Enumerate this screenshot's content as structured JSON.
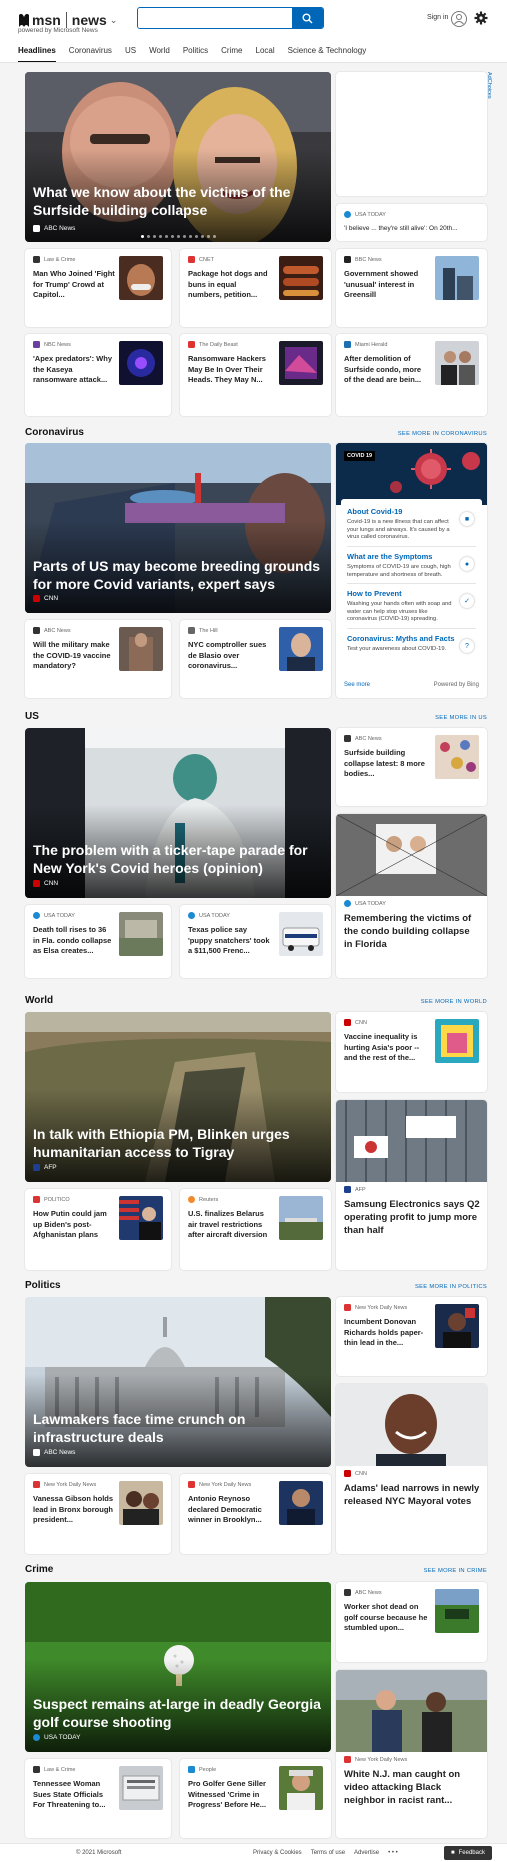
{
  "header": {
    "brand_msn": "msn",
    "brand_news": "news",
    "powered_by": "powered by Microsoft News",
    "search_placeholder": "",
    "signin": "Sign in"
  },
  "nav": [
    "Headlines",
    "Coronavirus",
    "US",
    "World",
    "Politics",
    "Crime",
    "Local",
    "Science & Technology"
  ],
  "adchoices": "AdChoices",
  "headlines": {
    "hero": {
      "title": "What we know about the victims of the Surfside building collapse",
      "source": "ABC News"
    },
    "side_card": {
      "source": "USA TODAY",
      "text": "'I believe ... they're still alive': On 20th..."
    },
    "cards": [
      {
        "source": "Law & Crime",
        "title": "Man Who Joined 'Fight for Trump' Crowd at Capitol..."
      },
      {
        "source": "CNET",
        "title": "Package hot dogs and buns in equal numbers, petition..."
      },
      {
        "source": "BBC News",
        "title": "Government showed 'unusual' interest in Greensill"
      },
      {
        "source": "NBC News",
        "title": "'Apex predators': Why the Kaseya ransomware attack..."
      },
      {
        "source": "The Daily Beast",
        "title": "Ransomware Hackers May Be In Over Their Heads. They May N..."
      },
      {
        "source": "Miami Herald",
        "title": "After demolition of Surfside condo, more of the dead are bein..."
      }
    ]
  },
  "coronavirus": {
    "heading": "Coronavirus",
    "see_more": "SEE MORE IN CORONAVIRUS",
    "hero": {
      "title": "Parts of US may become breeding grounds for more Covid variants, expert says",
      "source": "CNN"
    },
    "cards": [
      {
        "source": "ABC News",
        "title": "Will the military make the COVID-19 vaccine mandatory?"
      },
      {
        "source": "The Hill",
        "title": "NYC comptroller sues de Blasio over coronavirus..."
      }
    ],
    "panel": {
      "badge": "COVID 19",
      "items": [
        {
          "title": "About Covid-19",
          "text": "Covid-19 is a new illness that can affect your lungs and airways. It's caused by a virus called coronavirus."
        },
        {
          "title": "What are the Symptoms",
          "text": "Symptoms of COVID-19 are cough, high temperature and shortness of breath."
        },
        {
          "title": "How to Prevent",
          "text": "Washing your hands often with soap and water can help stop viruses like coronavirus (COVID-19) spreading."
        },
        {
          "title": "Coronavirus: Myths and Facts",
          "text": "Test your awareness about COVID-19."
        }
      ],
      "see_more": "See more",
      "powered": "Powered by Bing"
    }
  },
  "us": {
    "heading": "US",
    "see_more": "SEE MORE IN US",
    "hero": {
      "title": "The problem with a ticker-tape parade for New York's Covid heroes (opinion)",
      "source": "CNN"
    },
    "side_card": {
      "source": "ABC News",
      "title": "Surfside building collapse latest: 8 more bodies..."
    },
    "big_card": {
      "source": "USA TODAY",
      "title": "Remembering the victims of the condo building collapse in Florida"
    },
    "cards": [
      {
        "source": "USA TODAY",
        "title": "Death toll rises to 36 in Fla. condo collapse as Elsa creates..."
      },
      {
        "source": "USA TODAY",
        "title": "Texas police say 'puppy snatchers' took a $11,500 Frenc..."
      }
    ]
  },
  "world": {
    "heading": "World",
    "see_more": "SEE MORE IN WORLD",
    "hero": {
      "title": "In talk with Ethiopia PM, Blinken urges humanitarian access to Tigray",
      "source": "AFP"
    },
    "side_card": {
      "source": "CNN",
      "title": "Vaccine inequality is hurting Asia's poor -- and the rest of the..."
    },
    "big_card": {
      "source": "AFP",
      "title": "Samsung Electronics says Q2 operating profit to jump more than half"
    },
    "cards": [
      {
        "source": "POLITICO",
        "title": "How Putin could jam up Biden's post-Afghanistan plans"
      },
      {
        "source": "Reuters",
        "title": "U.S. finalizes Belarus air travel restrictions after aircraft diversion"
      }
    ]
  },
  "politics": {
    "heading": "Politics",
    "see_more": "SEE MORE IN POLITICS",
    "hero": {
      "title": "Lawmakers face time crunch on infrastructure deals",
      "source": "ABC News"
    },
    "side_card": {
      "source": "New York Daily News",
      "title": "Incumbent Donovan Richards holds paper-thin lead in the..."
    },
    "big_card": {
      "source": "CNN",
      "title": "Adams' lead narrows in newly released NYC Mayoral votes"
    },
    "cards": [
      {
        "source": "New York Daily News",
        "title": "Vanessa Gibson holds lead in Bronx borough president..."
      },
      {
        "source": "New York Daily News",
        "title": "Antonio Reynoso declared Democratic winner in Brooklyn..."
      }
    ]
  },
  "crime": {
    "heading": "Crime",
    "see_more": "SEE MORE IN CRIME",
    "hero": {
      "title": "Suspect remains at-large in deadly Georgia golf course shooting",
      "source": "USA TODAY"
    },
    "side_card": {
      "source": "ABC News",
      "title": "Worker shot dead on golf course because he stumbled upon..."
    },
    "big_card": {
      "source": "New York Daily News",
      "title": "White N.J. man caught on video attacking Black neighbor in racist rant..."
    },
    "cards": [
      {
        "source": "Law & Crime",
        "title": "Tennessee Woman Sues State Officials For Threatening to..."
      },
      {
        "source": "People",
        "title": "Pro Golfer Gene Siller Witnessed 'Crime in Progress' Before He..."
      }
    ]
  },
  "footer": {
    "copyright": "© 2021 Microsoft",
    "links": [
      "Privacy & Cookies",
      "Terms of use",
      "Advertise",
      "• • •"
    ],
    "feedback": "Feedback"
  }
}
